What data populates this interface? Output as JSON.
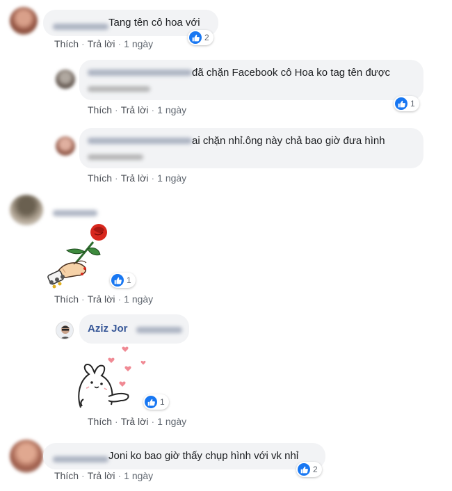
{
  "colors": {
    "link": "#385898",
    "like_blue": "#1877f2",
    "bubble_bg": "#f2f3f5",
    "meta_text": "#606770"
  },
  "actions": {
    "like": "Thích",
    "reply": "Trả lời",
    "separator": "·",
    "time": "1 ngày"
  },
  "comments": [
    {
      "text": "Tang tên cô hoa với",
      "reactions": "2"
    },
    {
      "text": "đã chặn Facebook cô Hoa ko tag tên được",
      "reactions": "1"
    },
    {
      "text": "ai chặn nhỉ.ông này chả bao giờ đưa hình",
      "reactions": ""
    },
    {
      "sticker": "hand-holding-rose",
      "reactions": "1"
    },
    {
      "name": "Aziz Jor",
      "sticker": "rabbit-with-hearts",
      "reactions": "1"
    },
    {
      "text": "Joni ko bao giờ thấy chụp hình với vk nhỉ",
      "reactions": "2"
    }
  ],
  "icons": {
    "like": "thumbs-up-icon",
    "rose": "rose-sticker",
    "rabbit": "rabbit-sticker"
  }
}
